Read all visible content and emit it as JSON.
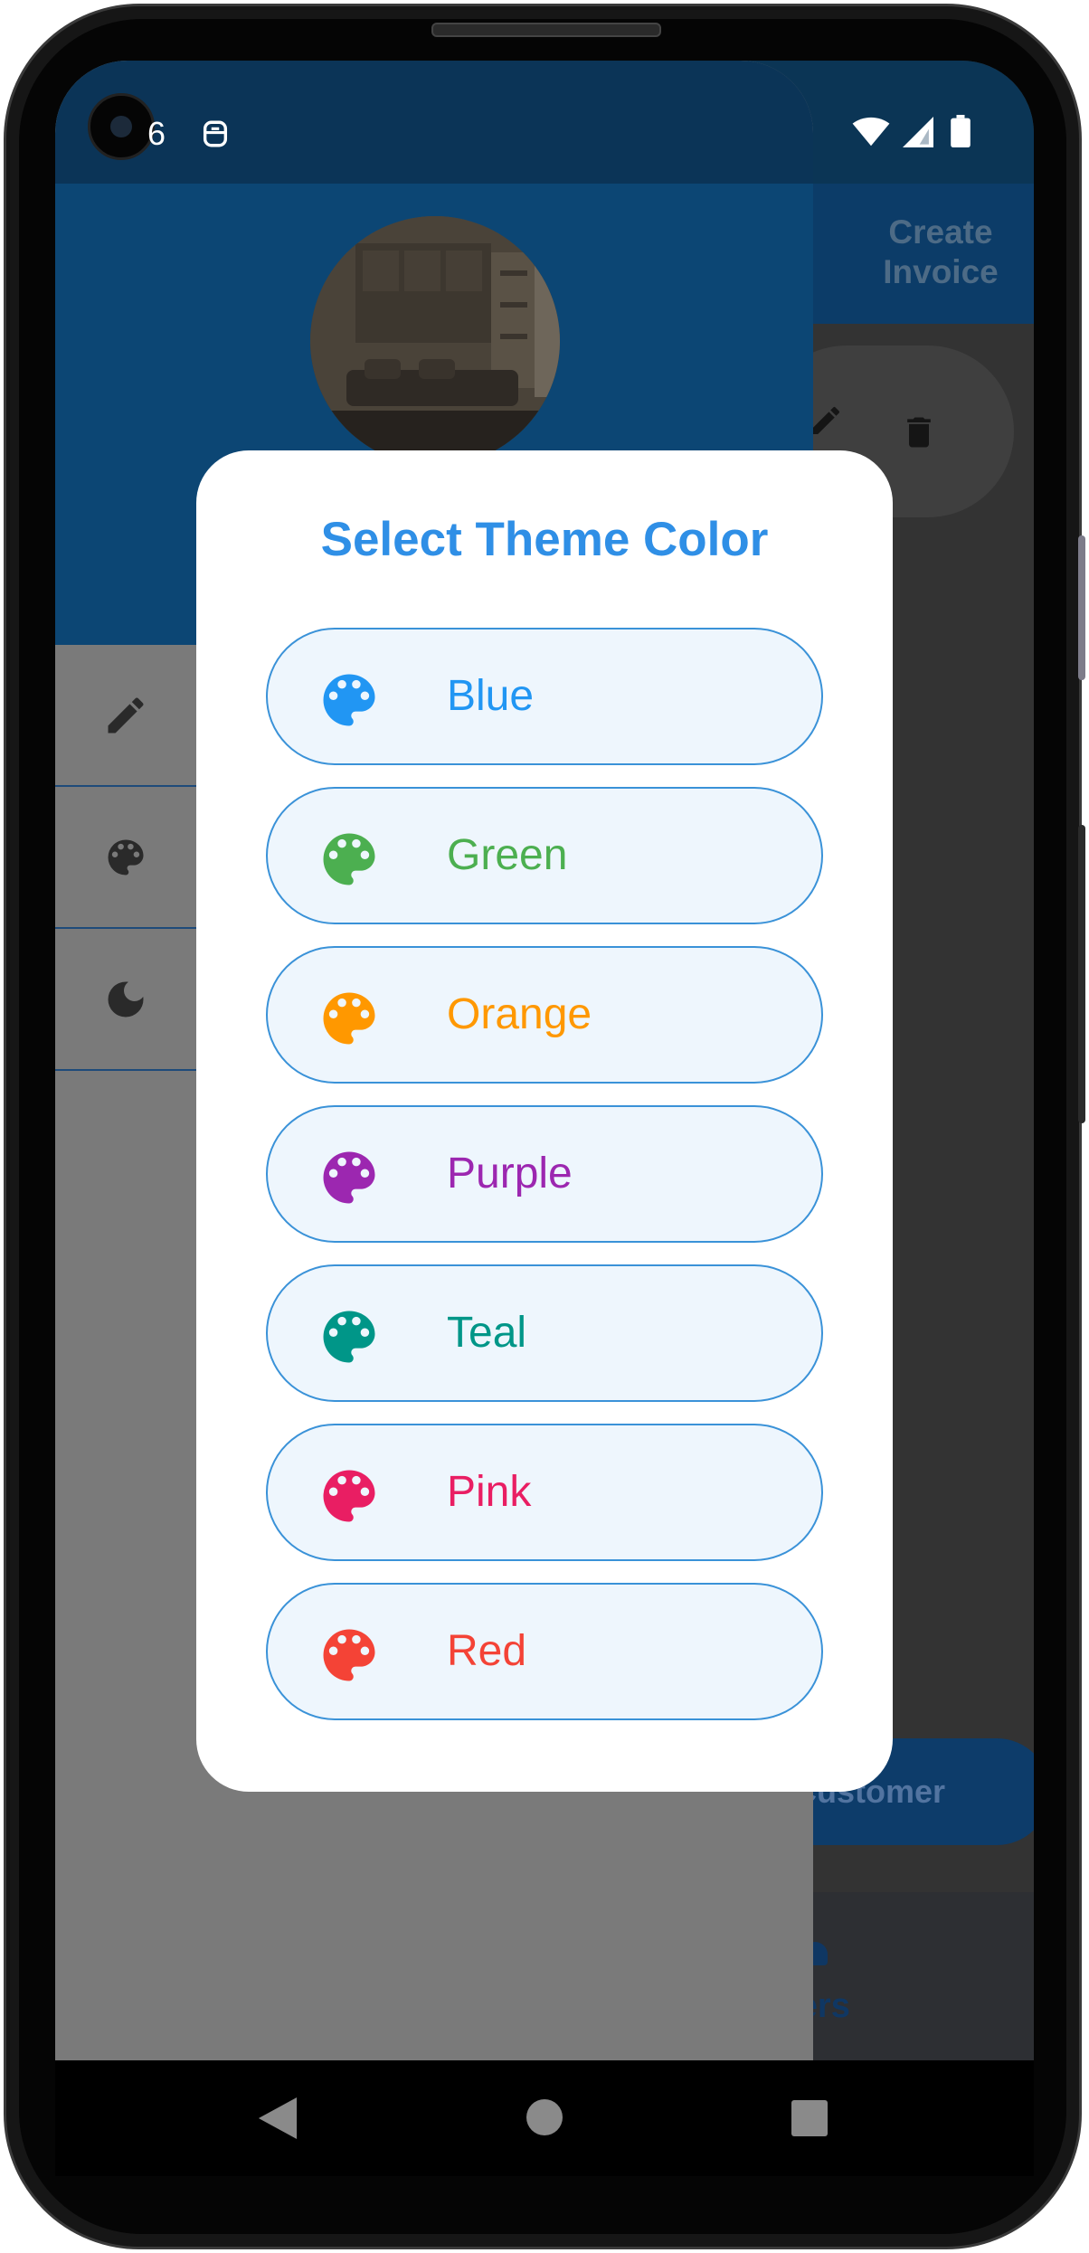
{
  "status_bar": {
    "left_text": "6"
  },
  "app": {
    "header_action": "Create Invoice",
    "fab_label": "Customer",
    "nav_label": "mers"
  },
  "dialog": {
    "title": "Select Theme Color",
    "options": [
      {
        "label": "Blue",
        "color": "#2196F3"
      },
      {
        "label": "Green",
        "color": "#4CAF50"
      },
      {
        "label": "Orange",
        "color": "#FF9800"
      },
      {
        "label": "Purple",
        "color": "#9C27B0"
      },
      {
        "label": "Teal",
        "color": "#009688"
      },
      {
        "label": "Pink",
        "color": "#E91E63"
      },
      {
        "label": "Red",
        "color": "#F44336"
      }
    ]
  },
  "colors": {
    "accent": "#2F8FE6",
    "option_border": "#3A92D8",
    "option_bg": "#EEF6FD"
  }
}
